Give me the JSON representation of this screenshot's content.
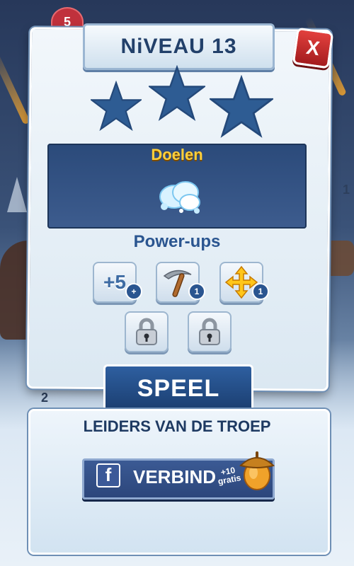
{
  "background": {
    "lives": "5",
    "left_number": "2",
    "right_number": "1"
  },
  "dialog": {
    "title": "NiVEAU 13",
    "close_label": "X",
    "stars_earned": 0,
    "stars_total": 3,
    "goals_title": "Doelen",
    "goal_icon": "snowball-icon",
    "powerups_title": "Power-ups",
    "powerups": [
      {
        "name": "plus-5-moves",
        "label": "+5",
        "count": "+"
      },
      {
        "name": "pickaxe-icon",
        "count": "1"
      },
      {
        "name": "move-arrows-icon",
        "count": "1"
      },
      {
        "name": "lock-icon"
      },
      {
        "name": "lock-icon"
      }
    ],
    "play_label": "SPEEL"
  },
  "leaders": {
    "title": "LEIDERS VAN DE TROEP",
    "connect_label": "VERBIND",
    "bonus_text": "+10 gratis",
    "facebook_letter": "f",
    "reward_icon": "acorn-icon"
  },
  "colors": {
    "title_text": "#22406a",
    "goal_title": "#ffcf3a",
    "play_button": "#2e5fa0",
    "close_button": "#d43a37",
    "facebook": "#3b5998"
  }
}
